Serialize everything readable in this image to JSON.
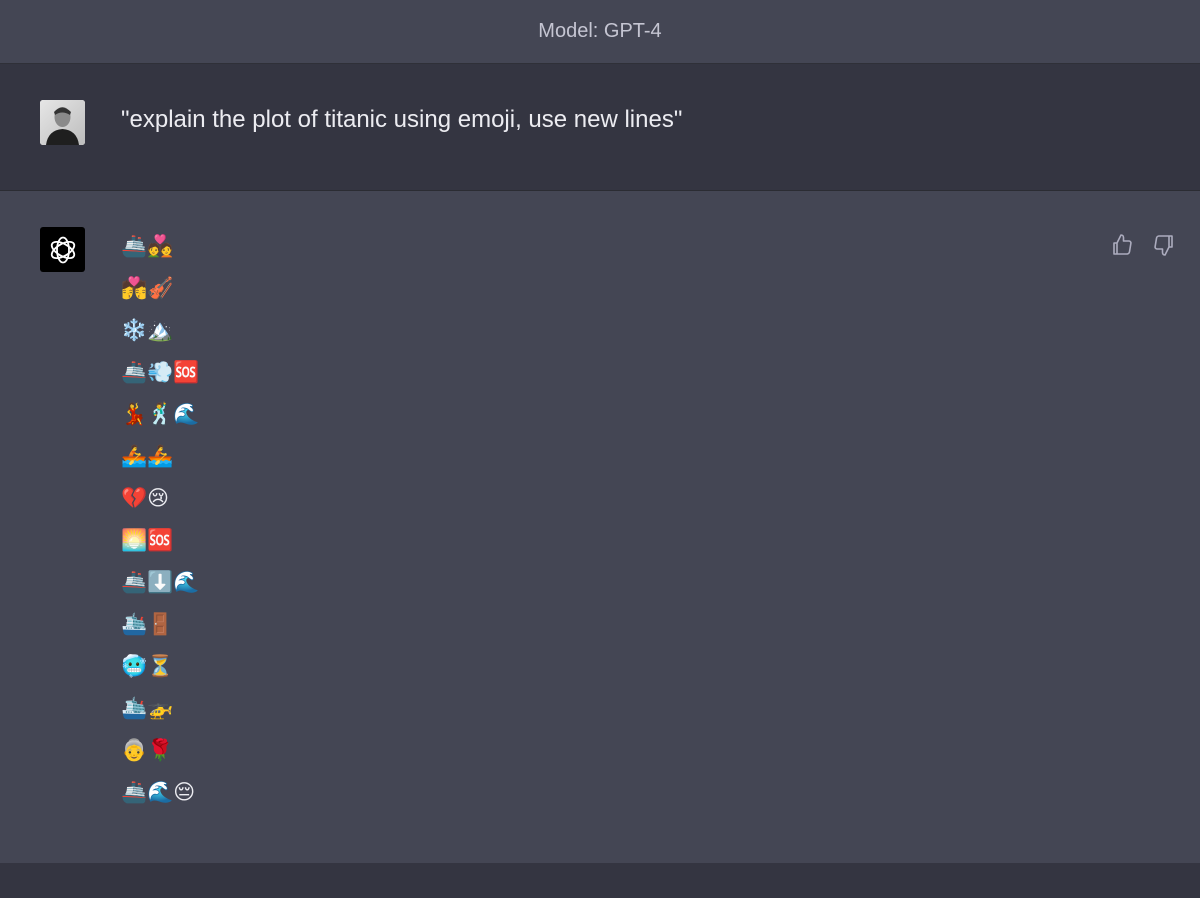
{
  "header": {
    "title": "Model: GPT-4"
  },
  "conversation": {
    "user": {
      "avatar_icon": "user-avatar-photo",
      "message": "\"explain the plot of titanic using emoji, use new lines\""
    },
    "assistant": {
      "avatar_icon": "openai-logo-icon",
      "lines": [
        "🚢💑",
        "💏🎻",
        "❄️🏔️",
        "🚢💨🆘",
        "💃🕺🌊",
        "🚣🚣",
        "💔😢",
        "🌅🆘",
        "🚢⬇️🌊",
        "🛳️🚪",
        "🥶⏳",
        "🛳️🚁",
        "👵🌹",
        "🚢🌊😔"
      ],
      "feedback": {
        "thumbs_up_icon": "thumbs-up-icon",
        "thumbs_down_icon": "thumbs-down-icon"
      }
    }
  },
  "colors": {
    "assistant_bg": "#444654",
    "user_bg": "#343541",
    "text": "#ececf1",
    "muted_text": "#c5c5d2",
    "icon": "#acacbe"
  }
}
